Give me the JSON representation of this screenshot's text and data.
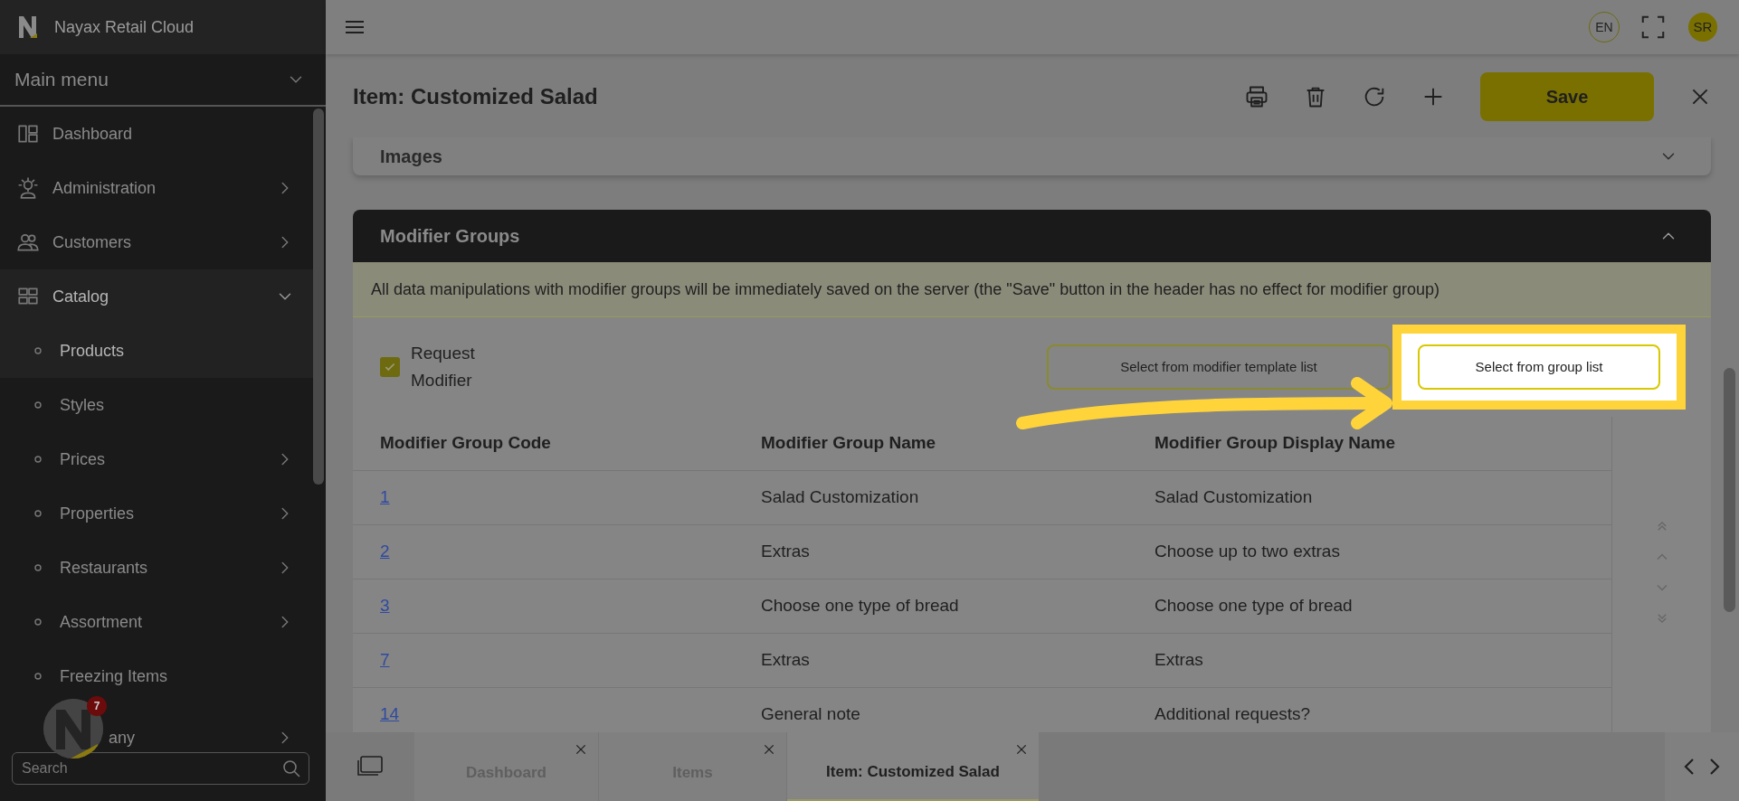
{
  "brand": {
    "name": "Nayax Retail Cloud"
  },
  "sidebar": {
    "title": "Main menu",
    "items": [
      {
        "label": "Dashboard",
        "has_arrow": false,
        "expanded": false
      },
      {
        "label": "Administration",
        "has_arrow": true,
        "expanded": false
      },
      {
        "label": "Customers",
        "has_arrow": true,
        "expanded": false
      },
      {
        "label": "Catalog",
        "has_arrow": true,
        "expanded": true,
        "children": [
          {
            "label": "Products",
            "has_arrow": false,
            "selected": true
          },
          {
            "label": "Styles",
            "has_arrow": false,
            "selected": false
          },
          {
            "label": "Prices",
            "has_arrow": true,
            "selected": false
          },
          {
            "label": "Properties",
            "has_arrow": true,
            "selected": false
          },
          {
            "label": "Restaurants",
            "has_arrow": true,
            "selected": false
          },
          {
            "label": "Assortment",
            "has_arrow": true,
            "selected": false
          },
          {
            "label": "Freezing Items",
            "has_arrow": false,
            "selected": false
          }
        ]
      },
      {
        "label": "any",
        "has_arrow": true,
        "expanded": false
      }
    ],
    "search": {
      "placeholder": "Search"
    }
  },
  "chat_bubble": {
    "badge": "7"
  },
  "topbar": {
    "language": "EN",
    "user": "SR"
  },
  "page": {
    "title": "Item: Customized Salad",
    "save": "Save"
  },
  "sections": [
    {
      "title": "Images",
      "expanded": false
    },
    {
      "title": "Modifier Groups",
      "expanded": true
    }
  ],
  "modifier_groups": {
    "notice": "All data manipulations with modifier groups will be immediately saved on the server (the \"Save\" button in the header has no effect for modifier group)",
    "request_modifier": {
      "label": "Request Modifier",
      "checked": true
    },
    "buttons": [
      {
        "label": "Select from modifier template list",
        "highlighted": false
      },
      {
        "label": "Select from group list",
        "highlighted": true
      }
    ],
    "table": {
      "columns": [
        "Modifier Group Code",
        "Modifier Group Name",
        "Modifier Group Display Name"
      ],
      "rows": [
        [
          "1",
          "Salad Customization",
          "Salad Customization"
        ],
        [
          "2",
          "Extras",
          "Choose up to two extras"
        ],
        [
          "3",
          "Choose one type of bread",
          "Choose one type of bread"
        ],
        [
          "7",
          "Extras",
          "Extras"
        ],
        [
          "14",
          "General note",
          "Additional requests?"
        ]
      ]
    }
  },
  "bottom_tabs": [
    {
      "label": "Dashboard",
      "selected": false
    },
    {
      "label": "Items",
      "selected": false
    },
    {
      "label": "Item: Customized Salad",
      "selected": true
    }
  ]
}
